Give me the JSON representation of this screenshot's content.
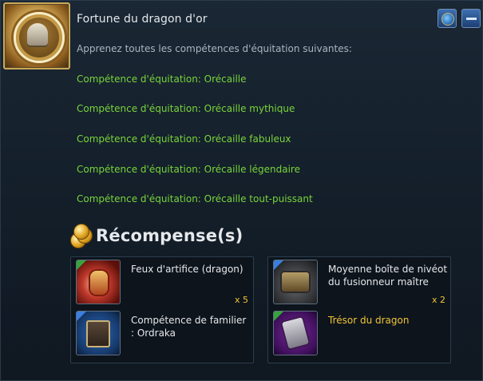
{
  "achievement": {
    "icon": "golden-bell-medallion-icon",
    "title": "Fortune du dragon d'or",
    "instruction": "Apprenez toutes les compétences d'équitation suivantes:",
    "skills": [
      "Compétence d'équitation: Orécaille",
      "Compétence d'équitation: Orécaille mythique",
      "Compétence d'équitation: Orécaille fabuleux",
      "Compétence d'équitation: Orécaille légendaire",
      "Compétence d'équitation: Orécaille tout-puissant"
    ]
  },
  "header_buttons": {
    "globe_icon": "globe-icon",
    "collapse_icon": "minus-icon"
  },
  "rewards": {
    "title": "Récompense(s)",
    "icon": "gold-coins-icon",
    "groups": [
      {
        "items": [
          {
            "name": "Feux d'artifice (dragon)",
            "quantity": "x 5",
            "icon": "fireworks-icon",
            "name_color": "#e6e8ea"
          },
          {
            "name": "Compétence de familier  : Ordraka",
            "quantity": "",
            "icon": "skill-book-icon",
            "name_color": "#e6e8ea"
          }
        ]
      },
      {
        "items": [
          {
            "name": "Moyenne boîte de nivéot du fusionneur maître",
            "quantity": "x 2",
            "icon": "treasure-box-icon",
            "name_color": "#e6e8ea"
          },
          {
            "name": "Trésor du dragon",
            "quantity": "",
            "icon": "dragon-treasure-icon",
            "name_color": "#f2c436"
          }
        ]
      }
    ]
  },
  "colors": {
    "skill_text": "#78d43a",
    "quantity": "#f2c436",
    "panel_bg": "#131e29"
  }
}
